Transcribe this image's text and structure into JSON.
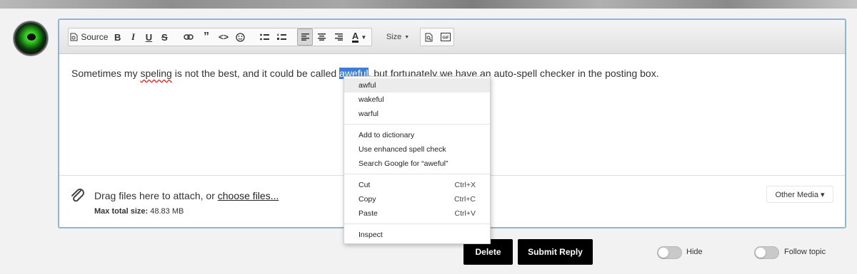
{
  "toolbar": {
    "source_label": "Source",
    "size_label": "Size",
    "icons": [
      "source-icon",
      "bold-icon",
      "italic-icon",
      "underline-icon",
      "strikethrough-icon",
      "link-icon",
      "quote-icon",
      "code-icon",
      "emoji-icon",
      "bulleted-list-icon",
      "numbered-list-icon",
      "align-left-icon",
      "align-center-icon",
      "align-right-icon",
      "text-color-icon",
      "preview-icon",
      "gif-icon"
    ]
  },
  "editor": {
    "text_before": "Sometimes my ",
    "misspelled_word": "speling",
    "text_middle": " is not the best, and it could be called ",
    "selected_word": "aweful",
    "text_after": ", but fortunately we have an auto-spell checker in the posting box."
  },
  "attach": {
    "drag_text": "Drag files here to attach, or ",
    "choose_link": "choose files...",
    "max_label": "Max total size:",
    "max_value": "48.83 MB",
    "other_media": "Other Media ▾"
  },
  "context_menu": {
    "suggestions": [
      "awful",
      "wakeful",
      "warful"
    ],
    "spell_actions": [
      "Add to dictionary",
      "Use enhanced spell check",
      "Search Google for “aweful”"
    ],
    "edit_actions": [
      {
        "label": "Cut",
        "shortcut": "Ctrl+X"
      },
      {
        "label": "Copy",
        "shortcut": "Ctrl+C"
      },
      {
        "label": "Paste",
        "shortcut": "Ctrl+V"
      }
    ],
    "inspect": "Inspect"
  },
  "actions": {
    "delete": "Delete",
    "submit": "Submit Reply",
    "hide": "Hide",
    "follow": "Follow topic"
  },
  "colors": {
    "selection": "#3a7fd5",
    "editor_border": "#8fb3d9",
    "button_bg": "#000000"
  }
}
